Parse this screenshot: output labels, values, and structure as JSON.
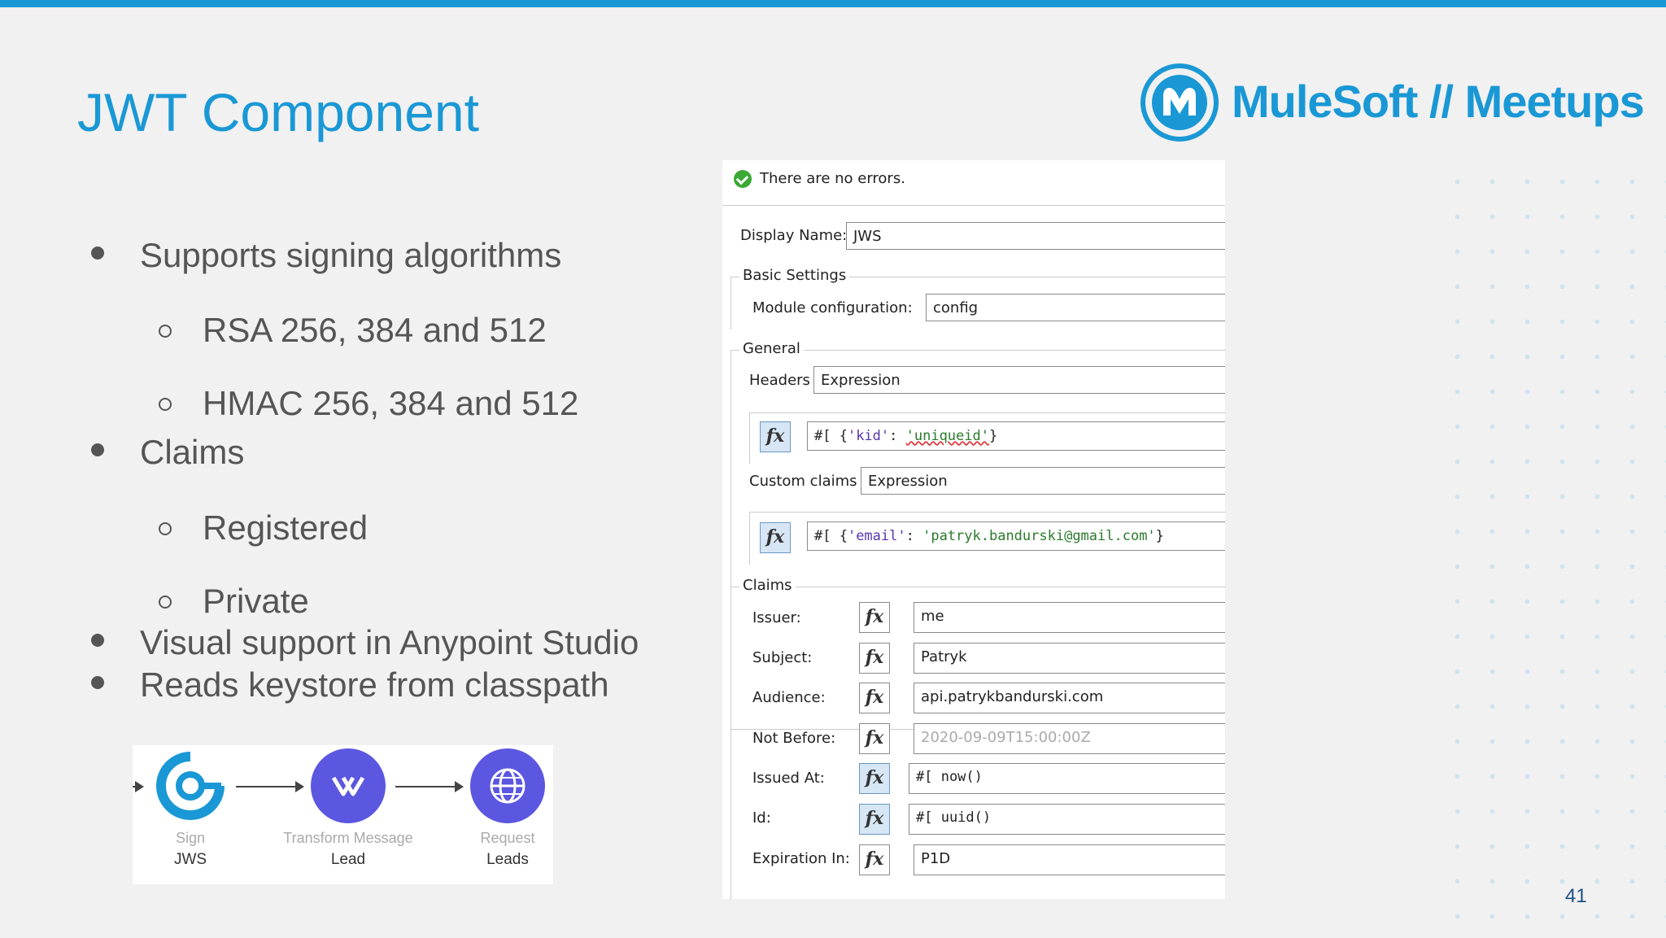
{
  "slide": {
    "title": "JWT Component",
    "page_number": "41",
    "accent_color": "#1a98d5"
  },
  "logo": {
    "text": "MuleSoft // Meetups",
    "icon": "mulesoft-logo-icon"
  },
  "bullets": [
    {
      "level": 1,
      "text": "Supports signing algorithms"
    },
    {
      "level": 2,
      "text": "RSA 256, 384 and 512"
    },
    {
      "level": 2,
      "text": "HMAC 256, 384 and 512"
    },
    {
      "level": 1,
      "text": "Claims"
    },
    {
      "level": 2,
      "text": "Registered"
    },
    {
      "level": 2,
      "text": "Private"
    },
    {
      "level": 1,
      "text": "Visual support in Anypoint Studio"
    },
    {
      "level": 1,
      "text": "Reads keystore from classpath"
    }
  ],
  "flow": {
    "nodes": [
      {
        "type": "Sign",
        "name": "JWS",
        "icon": "sign-jws-icon",
        "color": "#1a98d5"
      },
      {
        "type": "Transform Message",
        "name": "Lead",
        "icon": "transform-message-icon",
        "color": "#5b57e0"
      },
      {
        "type": "Request",
        "name": "Leads",
        "icon": "globe-request-icon",
        "color": "#5b57e0"
      }
    ]
  },
  "panel": {
    "status": "There are no errors.",
    "display_name_label": "Display Name:",
    "display_name_value": "JWS",
    "basic_settings_label": "Basic Settings",
    "module_config_label": "Module configuration:",
    "module_config_value": "config",
    "general_label": "General",
    "headers_label": "Headers",
    "headers_mode": "Expression",
    "headers_expr": {
      "prefix": "#[ {",
      "key": "'kid'",
      "colon": ": ",
      "value": "'uniqueid'",
      "suffix": "}"
    },
    "custom_claims_label": "Custom claims",
    "custom_claims_mode": "Expression",
    "custom_claims_expr": {
      "prefix": "#[ {",
      "key": "'email'",
      "colon": ": ",
      "value": "'patryk.bandurski@gmail.com'",
      "suffix": "}"
    },
    "claims_label": "Claims",
    "claims": [
      {
        "label": "Issuer:",
        "value": "me",
        "fx_active": false,
        "placeholder": false
      },
      {
        "label": "Subject:",
        "value": "Patryk",
        "fx_active": false,
        "placeholder": false
      },
      {
        "label": "Audience:",
        "value": "api.patrykbandurski.com",
        "fx_active": false,
        "placeholder": false
      },
      {
        "label": "Not Before:",
        "value": "2020-09-09T15:00:00Z",
        "fx_active": false,
        "placeholder": true
      },
      {
        "label": "Issued At:",
        "value": "#[ now()",
        "fx_active": true,
        "placeholder": false
      },
      {
        "label": "Id:",
        "value": "#[ uuid()",
        "fx_active": true,
        "placeholder": false
      },
      {
        "label": "Expiration In:",
        "value": "P1D",
        "fx_active": false,
        "placeholder": false
      }
    ],
    "fx_glyph": "fx"
  }
}
